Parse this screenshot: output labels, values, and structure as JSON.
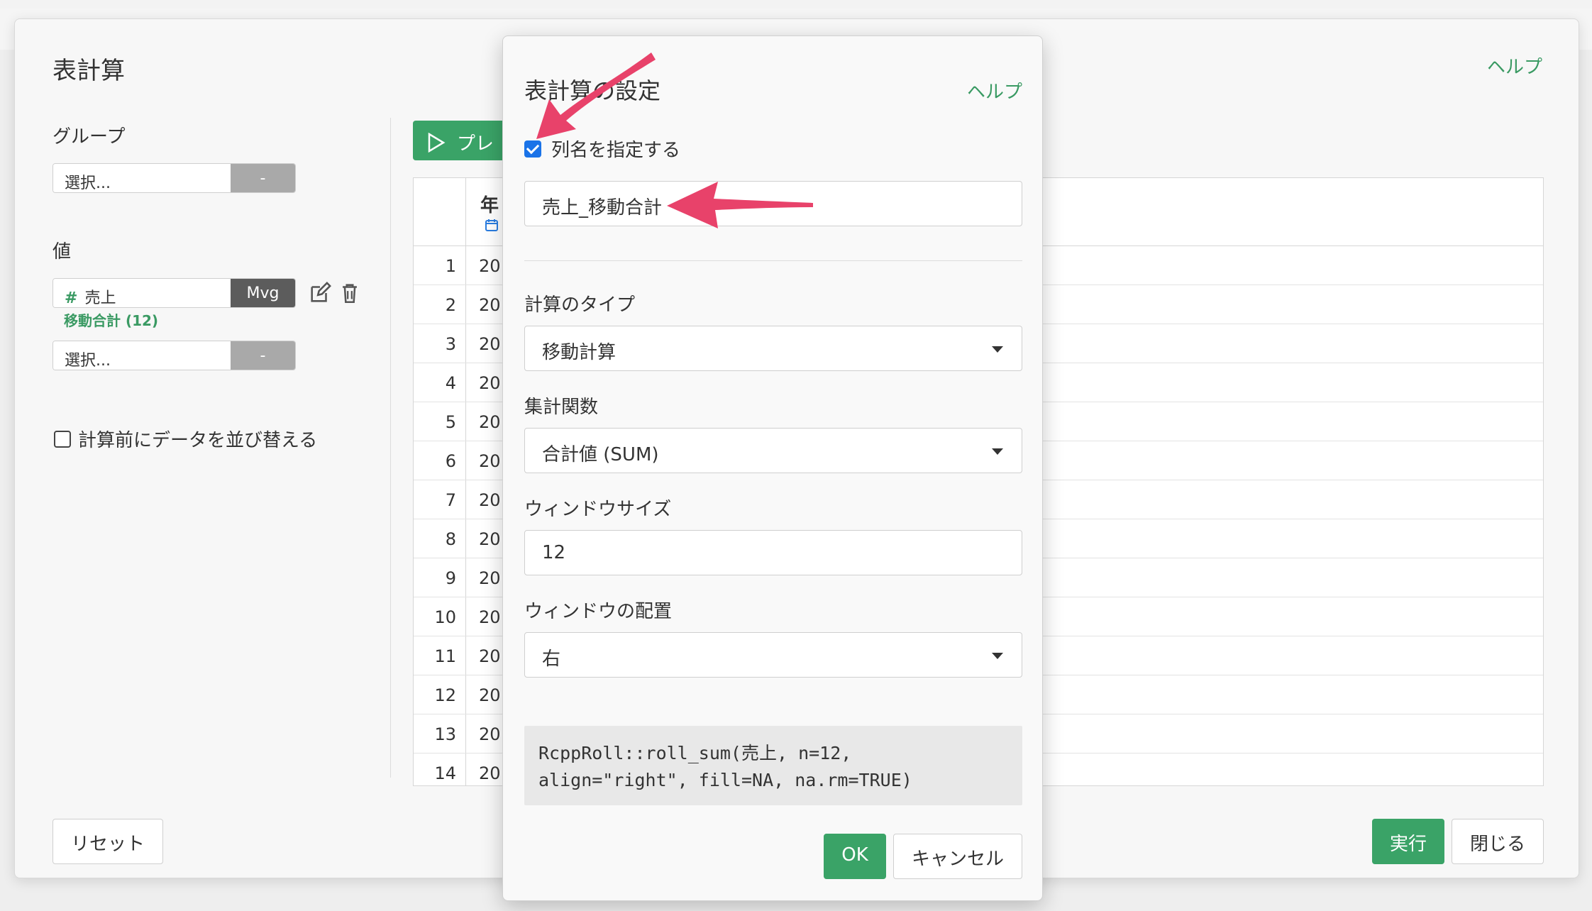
{
  "outer": {
    "title": "表計算",
    "help": "ヘルプ",
    "group_label": "グループ",
    "group_select": "選択...",
    "group_dash": "-",
    "value_label": "値",
    "value_field": "売上",
    "value_badge": "Mvg",
    "value_sub": "移動合計 (12)",
    "value_select2": "選択...",
    "value_dash2": "-",
    "sort_checkbox": "計算前にデータを並び替える",
    "preview_button": "プレ",
    "reset_button": "リセット",
    "run_button": "実行",
    "close_button": "閉じる"
  },
  "table": {
    "header_text": "年",
    "rows": [
      {
        "n": "1",
        "v": "20"
      },
      {
        "n": "2",
        "v": "20"
      },
      {
        "n": "3",
        "v": "20"
      },
      {
        "n": "4",
        "v": "20"
      },
      {
        "n": "5",
        "v": "20"
      },
      {
        "n": "6",
        "v": "20"
      },
      {
        "n": "7",
        "v": "20"
      },
      {
        "n": "8",
        "v": "20"
      },
      {
        "n": "9",
        "v": "20"
      },
      {
        "n": "10",
        "v": "20"
      },
      {
        "n": "11",
        "v": "20"
      },
      {
        "n": "12",
        "v": "20"
      },
      {
        "n": "13",
        "v": "20"
      },
      {
        "n": "14",
        "v": "20"
      }
    ]
  },
  "modal": {
    "title": "表計算の設定",
    "help": "ヘルプ",
    "checkbox_label": "列名を指定する",
    "checkbox_checked": true,
    "column_name_value": "売上_移動合計",
    "calc_type_label": "計算のタイプ",
    "calc_type_value": "移動計算",
    "agg_label": "集計関数",
    "agg_value": "合計値 (SUM)",
    "window_size_label": "ウィンドウサイズ",
    "window_size_value": "12",
    "window_align_label": "ウィンドウの配置",
    "window_align_value": "右",
    "code_preview": "RcppRoll::roll_sum(売上, n=12,\nalign=\"right\", fill=NA, na.rm=TRUE)",
    "ok_button": "OK",
    "cancel_button": "キャンセル"
  },
  "colors": {
    "accent_green": "#3aa367",
    "annotation_arrow": "#e8426a",
    "checkbox_blue": "#1a73e8"
  }
}
